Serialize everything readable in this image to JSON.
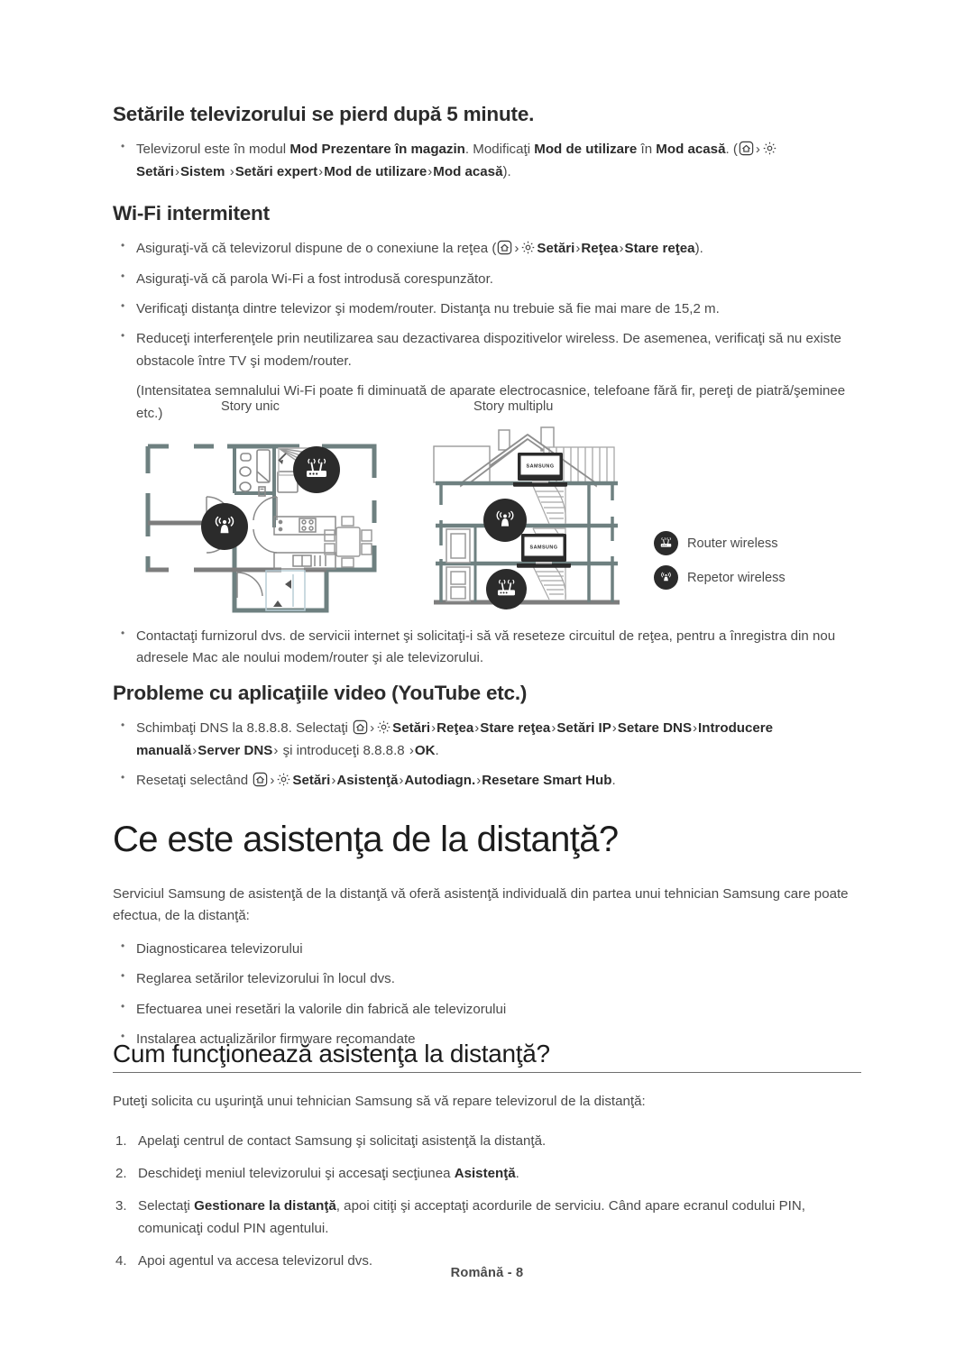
{
  "document": {
    "footer": "Română - 8"
  },
  "section_store_mode": {
    "heading": "Setările televizorului se pierd după 5 minute.",
    "bullet": {
      "t1": "Televizorul este în modul ",
      "b1": "Mod Prezentare în magazin",
      "t2": ". Modificaţi ",
      "b2": "Mod de utilizare",
      "t3": " în ",
      "b3": "Mod acasă",
      "t4": ". (",
      "icon_home": "home-icon",
      "sep": "›",
      "icon_gear": "gear-icon",
      "b4": "Setări",
      "b5": "Sistem",
      "b6": "Setări expert",
      "b7": "Mod de utilizare",
      "b8": "Mod acasă",
      "t5": ")."
    }
  },
  "section_wifi": {
    "heading": "Wi-Fi intermitent",
    "items": [
      {
        "pre": "Asiguraţi-vă că televizorul dispune de o conexiune la reţea (",
        "icon_home": "home-icon",
        "icon_gear": "gear-icon",
        "b1": "Setări",
        "b2": "Reţea",
        "b3": "Stare reţea",
        "post": ")."
      },
      {
        "text": "Asiguraţi-vă că parola Wi-Fi a fost introdusă corespunzător."
      },
      {
        "text": "Verificaţi distanţa dintre televizor şi modem/router. Distanţa nu trebuie să fie mai mare de 15,2 m."
      },
      {
        "text": "Reduceţi interferenţele prin neutilizarea sau dezactivarea dispozitivelor wireless. De asemenea, verificaţi să nu existe obstacole între TV şi modem/router."
      }
    ],
    "note": "(Intensitatea semnalului Wi-Fi poate fi diminuată de aparate electrocasnice, telefoane fără fir, pereţi de piatră/şeminee etc.)",
    "after_bullet": "Contactaţi furnizorul dvs. de servicii internet şi solicitaţi-i să vă reseteze circuitul de reţea, pentru a înregistra din nou adresele Mac ale noului modem/router şi ale televizorului."
  },
  "figure": {
    "caption_single": "Story unic",
    "caption_multi": "Story multiplu",
    "legend": [
      {
        "icon": "router-wireless-icon",
        "label": "Router wireless"
      },
      {
        "icon": "repeater-wireless-icon",
        "label": "Repetor wireless"
      }
    ],
    "tv_brand": "SAMSUNG"
  },
  "section_video_apps": {
    "heading": "Probleme cu aplicaţiile video (YouTube etc.)",
    "item1": {
      "pre": "Schimbaţi DNS la 8.8.8.8. Selectaţi ",
      "icon_home": "home-icon",
      "icon_gear": "gear-icon",
      "b1": "Setări",
      "b2": "Reţea",
      "b3": "Stare reţea",
      "b4": "Setări IP",
      "b5": "Setare DNS",
      "b6": "Introducere manuală",
      "b7": "Server DNS",
      "mid": " şi introduceţi 8.8.8.8 ",
      "b8": "OK",
      "post": "."
    },
    "item2": {
      "pre": "Resetaţi selectând ",
      "icon_home": "home-icon",
      "icon_gear": "gear-icon",
      "b1": "Setări",
      "b2": "Asistenţă",
      "b3": "Autodiagn.",
      "b4": "Resetare Smart Hub",
      "post": "."
    }
  },
  "section_remote_support": {
    "heading": "Ce este asistenţa de la distanţă?",
    "intro": "Serviciul Samsung de asistenţă de la distanţă vă oferă asistenţă individuală din partea unui tehnician Samsung care poate efectua, de la distanţă:",
    "items": [
      "Diagnosticarea televizorului",
      "Reglarea setărilor televizorului în locul dvs.",
      "Efectuarea unei resetări la valorile din fabrică ale televizorului",
      "Instalarea actualizărilor firmware recomandate"
    ]
  },
  "section_how_it_works": {
    "heading": "Cum funcţionează asistenţa la distanţă?",
    "intro": "Puteţi solicita cu uşurinţă unui tehnician Samsung să vă repare televizorul de la distanţă:",
    "steps": [
      {
        "text": "Apelaţi centrul de contact Samsung şi solicitaţi asistenţă la distanţă."
      },
      {
        "pre": "Deschideţi meniul televizorului şi accesaţi secţiunea ",
        "bold": "Asistenţă",
        "post": "."
      },
      {
        "pre": "Selectaţi ",
        "bold": "Gestionare la distanţă",
        "post": ", apoi citiţi şi acceptaţi acordurile de serviciu. Când apare ecranul codului PIN, comunicaţi codul PIN agentului."
      },
      {
        "text": "Apoi agentul va accesa televizorul dvs."
      }
    ]
  },
  "colors": {
    "text": "#4a4a4a",
    "heading": "#1c1c1c",
    "wall": "#6e8080",
    "wall_dark": "#707070",
    "icon_circle": "#2b2b2b"
  }
}
